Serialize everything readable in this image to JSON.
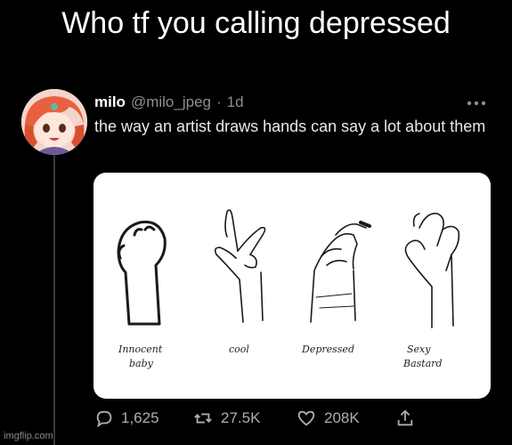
{
  "meme": {
    "caption": "Who tf you calling depressed",
    "watermark": "imgflip.com"
  },
  "tweet": {
    "display_name": "milo",
    "handle": "@milo_jpeg",
    "separator": "·",
    "time": "1d",
    "text": "the way an artist draws hands can say a lot about them",
    "avatar_icon": "anime-character-avatar",
    "more_icon": "more-dots-icon"
  },
  "media": {
    "hands": [
      {
        "label_line1": "Innocent",
        "label_line2": "baby"
      },
      {
        "label_line1": "cool",
        "label_line2": ""
      },
      {
        "label_line1": "Depressed",
        "label_line2": ""
      },
      {
        "label_line1": "Sexy",
        "label_line2": "Bastard"
      }
    ]
  },
  "actions": {
    "replies": "1,625",
    "retweets": "27.5K",
    "likes": "208K",
    "icons": [
      "reply-icon",
      "retweet-icon",
      "like-icon",
      "share-icon"
    ]
  },
  "colors": {
    "background": "#000000",
    "card": "#ffffff",
    "muted_text": "#8b9096"
  }
}
